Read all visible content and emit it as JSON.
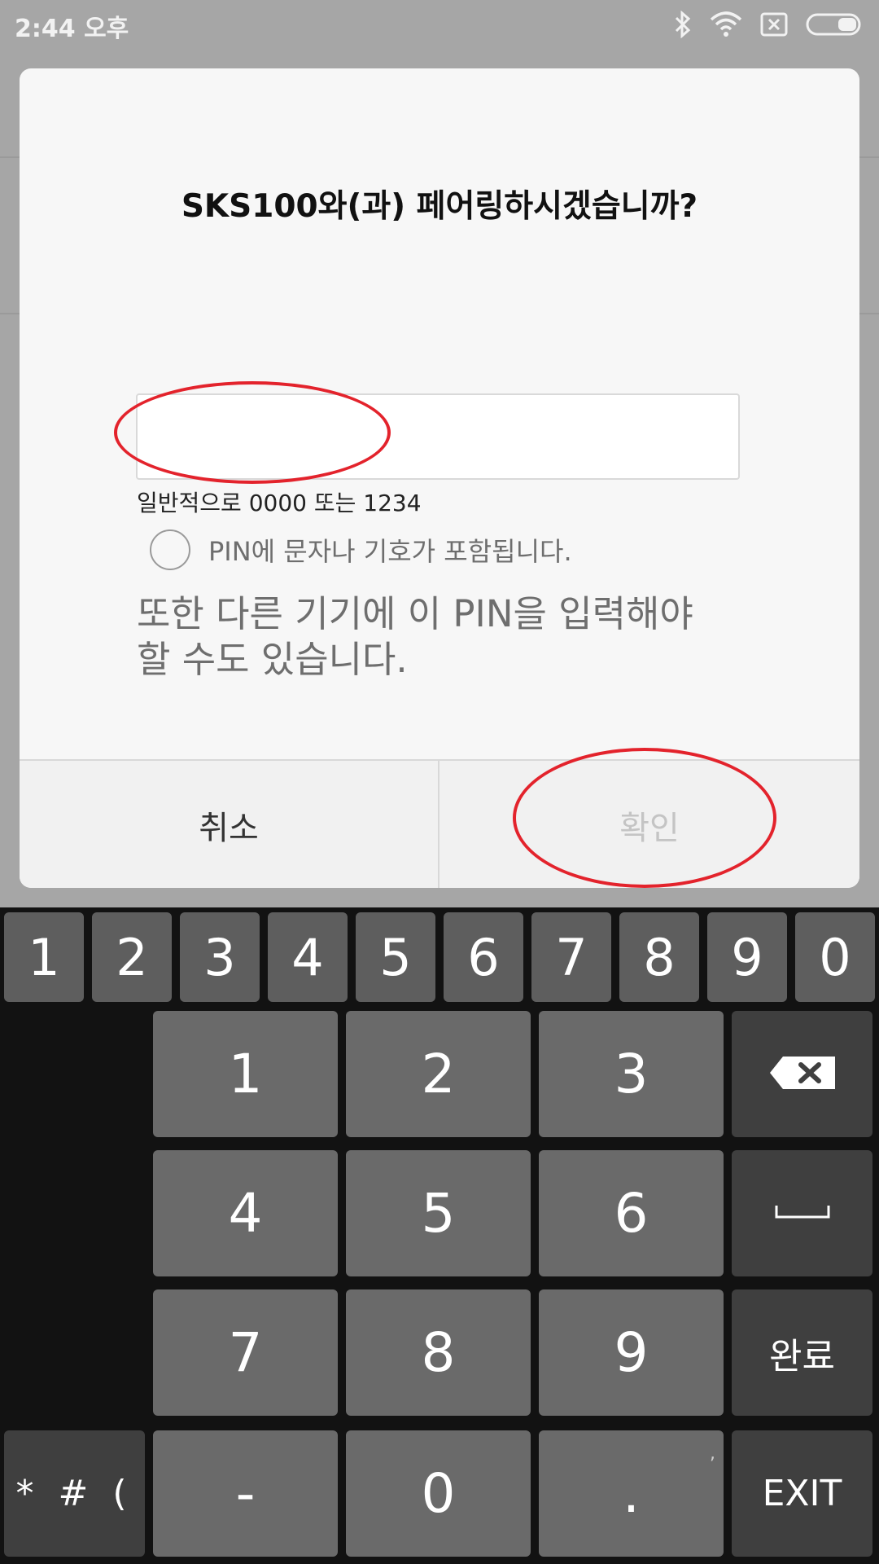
{
  "status_bar": {
    "time": "2:44 오후",
    "icons": [
      "bluetooth-icon",
      "wifi-icon",
      "no-sim-icon",
      "battery-icon"
    ]
  },
  "dialog": {
    "title": "SKS100와(과) 페어링하시겠습니까?",
    "pin_input": {
      "value": "",
      "placeholder": ""
    },
    "hint": "일반적으로 0000 또는 1234",
    "checkbox_label": "PIN에 문자나 기호가 포함됩니다.",
    "checkbox_checked": false,
    "info_line1": "또한 다른 기기에 이 PIN을 입력해야",
    "info_line2": "할 수도 있습니다.",
    "cancel_label": "취소",
    "ok_label": "확인",
    "ok_enabled": false
  },
  "annotations": {
    "color": "#e3232c",
    "count": 2
  },
  "keyboard": {
    "top_row": [
      "1",
      "2",
      "3",
      "4",
      "5",
      "6",
      "7",
      "8",
      "9",
      "0"
    ],
    "numpad": [
      "1",
      "2",
      "3",
      "4",
      "5",
      "6",
      "7",
      "8",
      "9",
      "-",
      "0",
      "."
    ],
    "period_alt": ",",
    "symbols_label": "* # (",
    "done_label": "완료",
    "exit_label": "EXIT",
    "backspace_icon": "backspace-icon",
    "space_icon": "space-icon"
  },
  "colors": {
    "scrim": "#a6a6a6",
    "dialog_bg": "#f7f7f7",
    "keyboard_bg": "#121212",
    "key_light": "#6a6a6a",
    "key_dark": "#3f3f3f"
  }
}
